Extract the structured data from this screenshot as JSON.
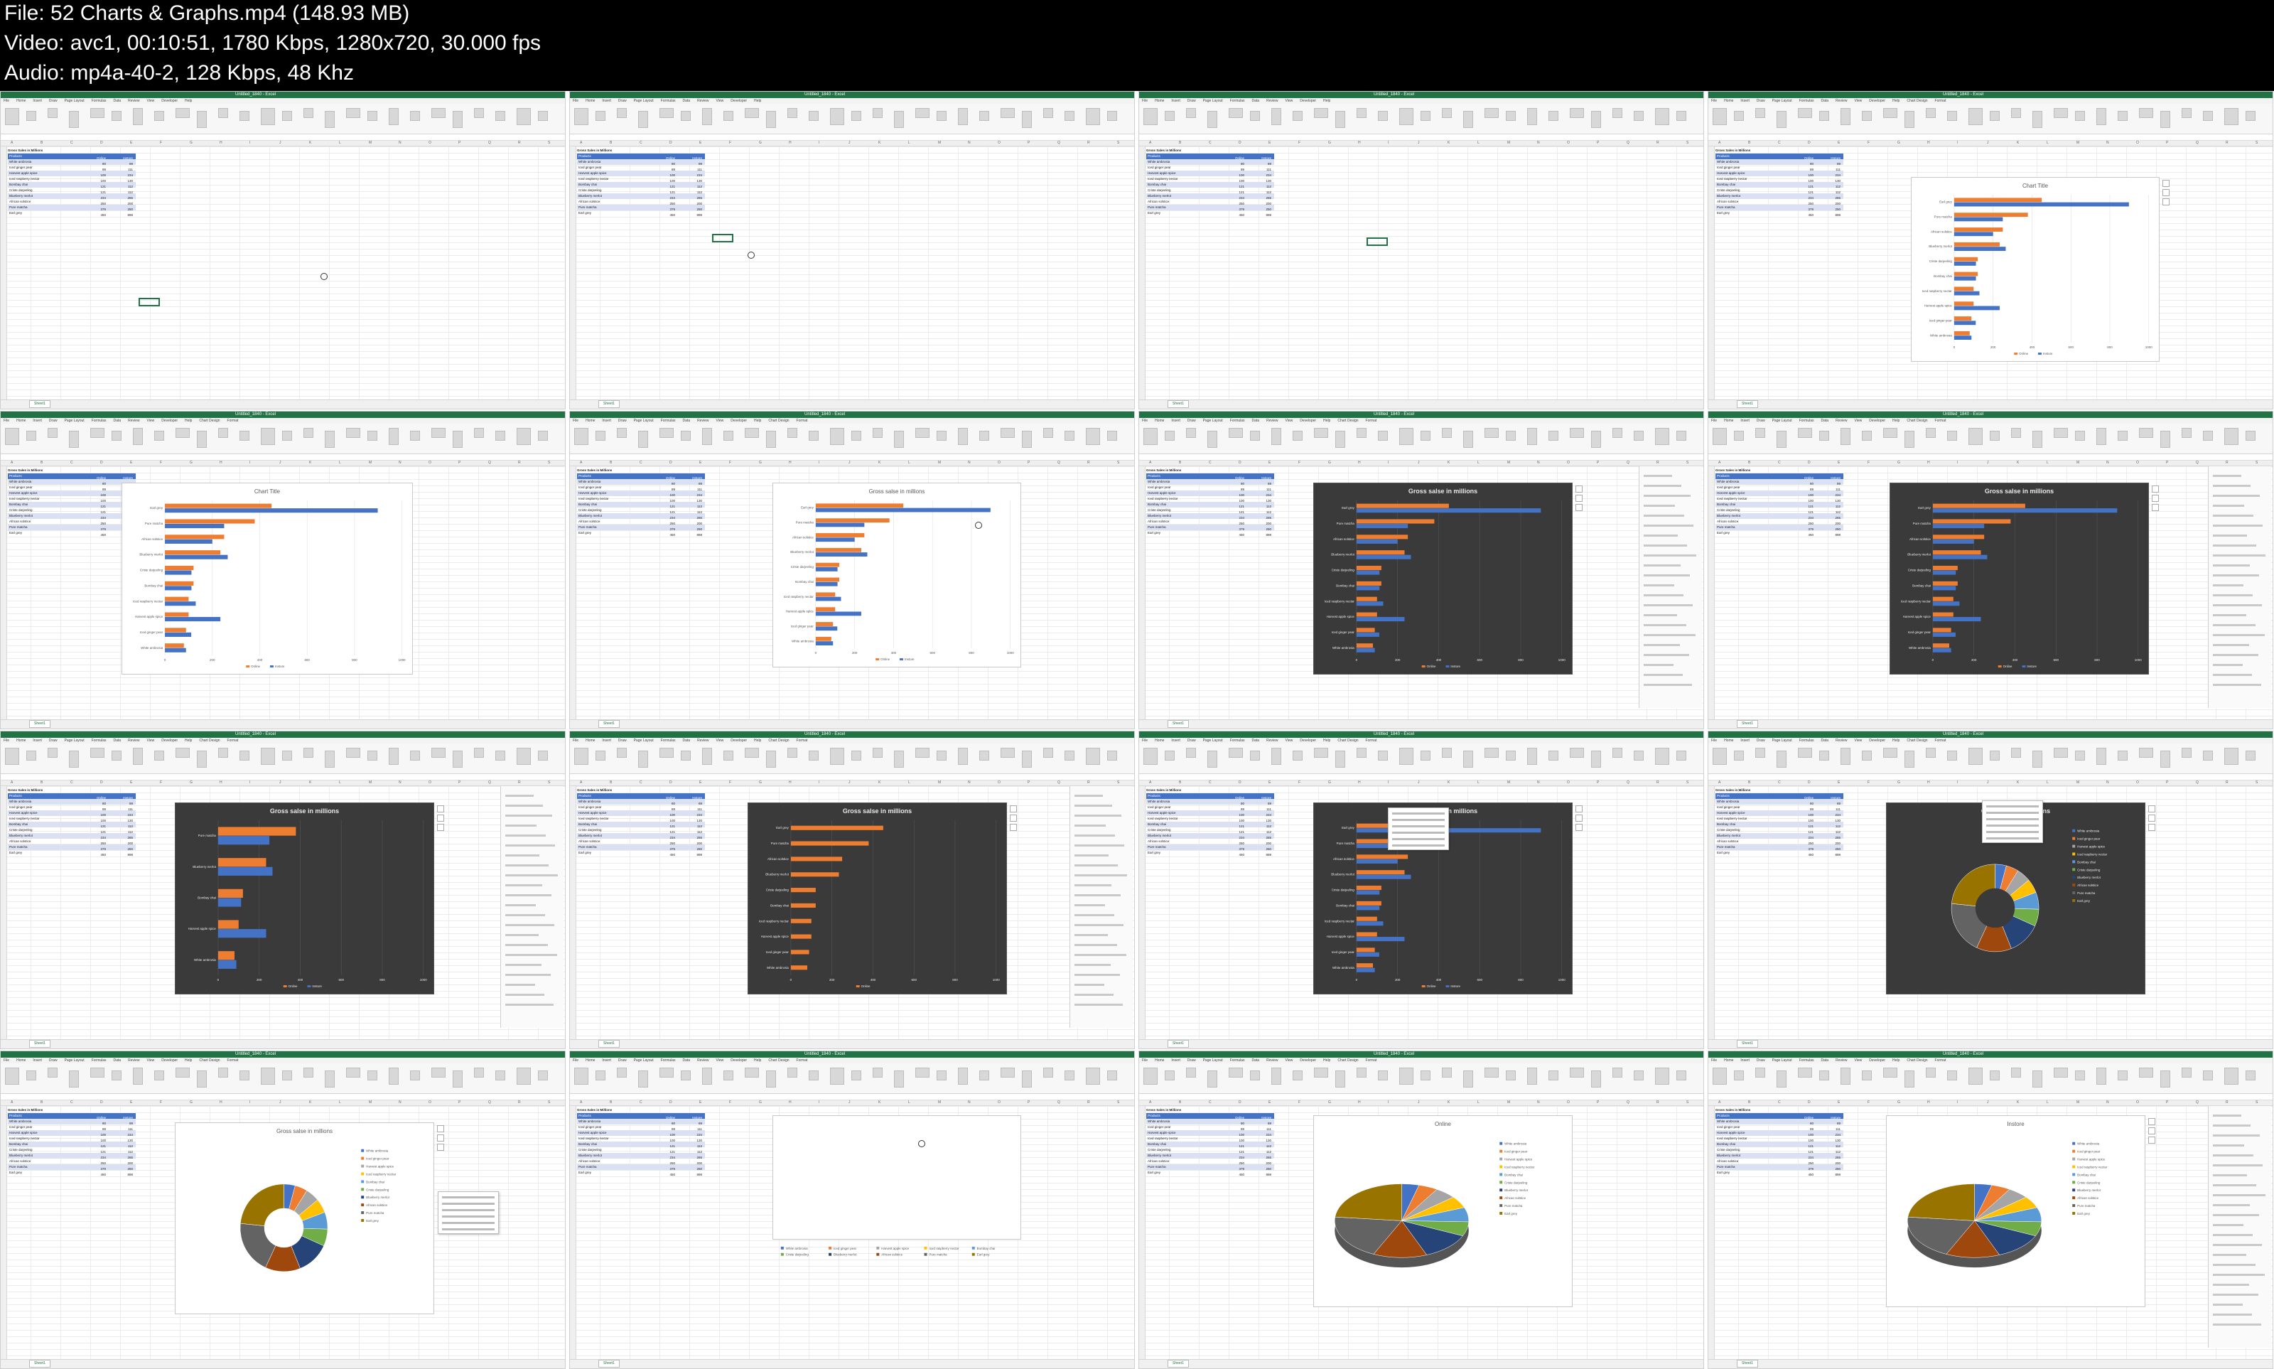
{
  "header": {
    "file_line": "File: 52  Charts & Graphs.mp4 (148.93 MB)",
    "video_line": "Video: avc1, 00:10:51, 1780 Kbps, 1280x720, 30.000 fps",
    "audio_line": "Audio: mp4a-40-2, 128 Kbps, 48 Khz"
  },
  "app": {
    "window_title": "Untitled_1840 - Excel",
    "ribbon_tabs": [
      "File",
      "Home",
      "Insert",
      "Draw",
      "Page Layout",
      "Formulas",
      "Data",
      "Review",
      "View",
      "Developer",
      "Help",
      "Chart Design",
      "Format"
    ],
    "sheet_tab": "Sheet1",
    "table_title": "Gross Sales in Millions",
    "table_headers": [
      "Products",
      "Online",
      "Instore"
    ],
    "colors": {
      "excel_green": "#217346",
      "table_header": "#4472c4",
      "table_band": "#d9e1f2",
      "series_online": "#ed7d31",
      "series_instore": "#4472c4",
      "dark_chart": "#3a3a3a"
    }
  },
  "table": {
    "products": [
      "White ambrosia",
      "Iced ginger pear",
      "Harvest apple spice",
      "Iced raspberry nectar",
      "Bombay chai",
      "Criste darjeeling",
      "Blueberry merlot",
      "African solstice",
      "Pure matcha",
      "Earl grey"
    ],
    "online": [
      80,
      89,
      100,
      100,
      121,
      121,
      234,
      250,
      379,
      450
    ],
    "instore": [
      89,
      111,
      234,
      130,
      112,
      112,
      265,
      200,
      250,
      898
    ]
  },
  "charts": {
    "chart_title_default": "Chart Title",
    "chart_title_custom": "Gross salse in millions",
    "pie_title_online": "Online",
    "pie_title_instore": "Instore",
    "legend_online": "Online",
    "legend_instore": "Instore"
  },
  "chart_data": [
    {
      "type": "bar",
      "orientation": "horizontal",
      "title": "Chart Title",
      "categories": [
        "White ambrosia",
        "Iced ginger pear",
        "Harvest apple spice",
        "Iced raspberry nectar",
        "Bombay chai",
        "Criste darjeeling",
        "Blueberry merlot",
        "African solstice",
        "Pure matcha",
        "Earl grey"
      ],
      "series": [
        {
          "name": "Online",
          "values": [
            80,
            89,
            100,
            100,
            121,
            121,
            234,
            250,
            379,
            450
          ]
        },
        {
          "name": "Instore",
          "values": [
            89,
            111,
            234,
            130,
            112,
            112,
            265,
            200,
            250,
            898
          ]
        }
      ],
      "xlim": [
        0,
        1000
      ],
      "legend": "bottom"
    },
    {
      "type": "bar",
      "orientation": "horizontal",
      "title": "Gross salse in millions",
      "categories": [
        "White ambrosia",
        "Iced ginger pear",
        "Harvest apple spice",
        "Iced raspberry nectar",
        "Bombay chai",
        "Criste darjeeling",
        "Blueberry merlot",
        "African solstice",
        "Pure matcha",
        "Earl grey"
      ],
      "series": [
        {
          "name": "Online",
          "values": [
            80,
            89,
            100,
            100,
            121,
            121,
            234,
            250,
            379,
            450
          ]
        },
        {
          "name": "Instore",
          "values": [
            89,
            111,
            234,
            130,
            112,
            112,
            265,
            200,
            250,
            898
          ]
        }
      ],
      "xlim": [
        0,
        1000
      ],
      "legend": "bottom"
    },
    {
      "type": "pie",
      "title": "Online",
      "categories": [
        "White ambrosia",
        "Iced ginger pear",
        "Harvest apple spice",
        "Iced raspberry nectar",
        "Bombay chai",
        "Criste darjeeling",
        "Blueberry merlot",
        "African solstice",
        "Pure matcha",
        "Earl grey"
      ],
      "values": [
        80,
        89,
        100,
        100,
        121,
        121,
        234,
        250,
        379,
        450
      ],
      "legend": "right"
    }
  ]
}
